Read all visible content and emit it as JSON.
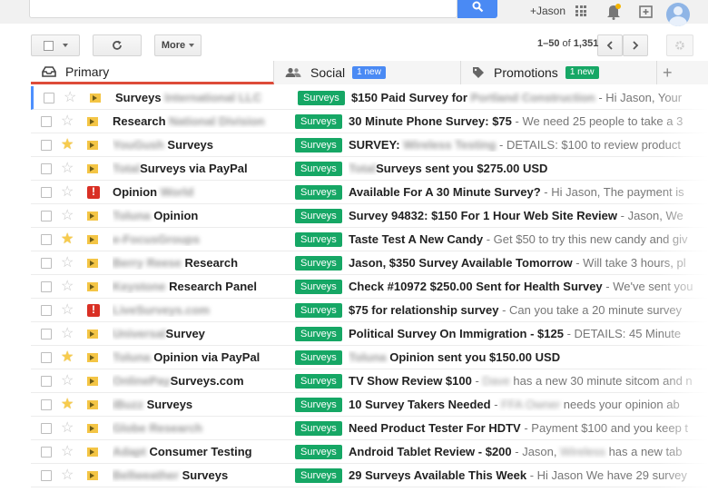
{
  "topbar": {
    "user_label": "+Jason"
  },
  "toolbar": {
    "more_label": "More",
    "page_range": "1–50",
    "page_of": "of",
    "page_total": "1,351"
  },
  "tabs": [
    {
      "label": "Primary",
      "badge": ""
    },
    {
      "label": "Social",
      "badge": "1 new"
    },
    {
      "label": "Promotions",
      "badge": "1 new"
    }
  ],
  "colors": {
    "label_green": "#16a765",
    "search_blue": "#4a8af4",
    "primary_tab_red": "#dd4b39"
  },
  "emails": [
    {
      "sender_pre": "Surveys",
      "sender_blur": "International LLC",
      "sender_post": "",
      "label": "Surveys",
      "subject": "$150 Paid Survey for",
      "subject_blur": "Portland Construction",
      "snippet": " - Hi Jason, Your",
      "starred": false,
      "important": "normal"
    },
    {
      "sender_pre": "Research",
      "sender_blur": "National Division",
      "sender_post": "",
      "label": "Surveys",
      "subject": "30 Minute Phone Survey: $75",
      "subject_blur": "",
      "snippet": " - We need 25 people to take a 3",
      "starred": false,
      "important": "normal"
    },
    {
      "sender_pre": "",
      "sender_blur": "YouGush",
      "sender_post": " Surveys",
      "label": "Surveys",
      "subject": "SURVEY:",
      "subject_blur": "Wireless Testing",
      "snippet": " - DETAILS: $100 to review product",
      "starred": true,
      "important": "normal"
    },
    {
      "sender_pre": "",
      "sender_blur": "Total",
      "sender_post": "Surveys via PayPal",
      "label": "Surveys",
      "subject": "",
      "subject_blur": "Total",
      "snippet_bold": "Surveys sent you $275.00 USD",
      "snippet": "",
      "starred": false,
      "important": "normal"
    },
    {
      "sender_pre": "Opinion",
      "sender_blur": "World",
      "sender_post": "",
      "label": "Surveys",
      "subject": "Available For A 30 Minute Survey?",
      "subject_blur": "",
      "snippet": " - Hi Jason, The payment is",
      "starred": false,
      "important": "red"
    },
    {
      "sender_pre": "",
      "sender_blur": "Toluna",
      "sender_post": " Opinion",
      "label": "Surveys",
      "subject": "Survey 94832: $150 For 1 Hour Web Site Review",
      "subject_blur": "",
      "snippet": " - Jason, We",
      "starred": false,
      "important": "normal"
    },
    {
      "sender_pre": "",
      "sender_blur": "e-FocusGroups",
      "sender_post": "",
      "label": "Surveys",
      "subject": "Taste Test A New Candy",
      "subject_blur": "",
      "snippet": " - Get $50 to try this new candy and giv",
      "starred": true,
      "important": "normal"
    },
    {
      "sender_pre": "",
      "sender_blur": "Berry Reese",
      "sender_post": " Research",
      "label": "Surveys",
      "subject": "Jason, $350 Survey Available Tomorrow",
      "subject_blur": "",
      "snippet": " - Will take 3 hours, pl",
      "starred": false,
      "important": "normal"
    },
    {
      "sender_pre": "",
      "sender_blur": "Keystone",
      "sender_post": " Research Panel",
      "label": "Surveys",
      "subject": "Check #10972 $250.00 Sent for Health Survey",
      "subject_blur": "",
      "snippet": " - We've sent you",
      "starred": false,
      "important": "normal"
    },
    {
      "sender_pre": "",
      "sender_blur": "LiveSurveys.com",
      "sender_post": "",
      "label": "Surveys",
      "subject": "$75 for relationship survey",
      "subject_blur": "",
      "snippet": " - Can you take a 20 minute survey",
      "starred": false,
      "important": "red"
    },
    {
      "sender_pre": "",
      "sender_blur": "Universal",
      "sender_post": "Survey",
      "label": "Surveys",
      "subject": "Political Survey On Immigration - $125",
      "subject_blur": "",
      "snippet": " - DETAILS: 45 Minute",
      "starred": false,
      "important": "normal"
    },
    {
      "sender_pre": "",
      "sender_blur": "Toluna",
      "sender_post": " Opinion via PayPal",
      "label": "Surveys",
      "subject": "",
      "subject_blur": "Toluna",
      "snippet_bold": " Opinion sent you $150.00 USD",
      "snippet": "",
      "starred": true,
      "important": "normal"
    },
    {
      "sender_pre": "",
      "sender_blur": "OnlinePay",
      "sender_post": "Surveys.com",
      "label": "Surveys",
      "subject": "TV Show Review $100",
      "subject_blur": "",
      "snippet_blur": "Dave",
      "snippet": " has a new 30 minute sitcom and n",
      "starred": false,
      "important": "normal"
    },
    {
      "sender_pre": "",
      "sender_blur": "iBuzz",
      "sender_post": " Surveys",
      "label": "Surveys",
      "subject": "10 Survey Takers Needed",
      "subject_blur": "",
      "snippet_blur": "FFA Owner",
      "snippet": " needs your opinion ab",
      "starred": true,
      "important": "normal"
    },
    {
      "sender_pre": "",
      "sender_blur": "Globe Research",
      "sender_post": "",
      "label": "Surveys",
      "subject": "Need Product Tester For HDTV",
      "subject_blur": "",
      "snippet": " - Payment $100 and you keep t",
      "starred": false,
      "important": "normal"
    },
    {
      "sender_pre": "",
      "sender_blur": "Adapt",
      "sender_post": " Consumer Testing",
      "label": "Surveys",
      "subject": "Android Tablet Review - $200",
      "subject_blur": "",
      "snippet": " - Jason, ",
      "snippet_blur": "Wireless",
      "snippet_tail": " has a new tab",
      "starred": false,
      "important": "normal"
    },
    {
      "sender_pre": "",
      "sender_blur": "Bellweather",
      "sender_post": " Surveys",
      "label": "Surveys",
      "subject": "29 Surveys Available This Week",
      "subject_blur": "",
      "snippet": " - Hi Jason We have 29 survey",
      "starred": false,
      "important": "normal"
    }
  ]
}
